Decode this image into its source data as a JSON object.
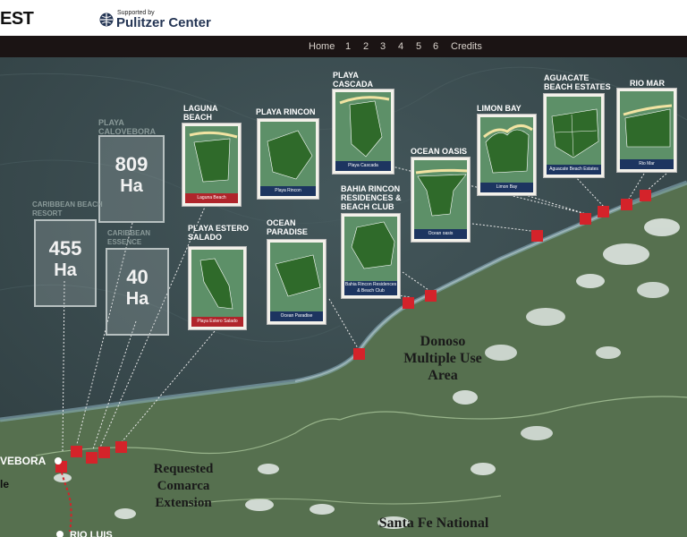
{
  "header": {
    "logo_text": "EST",
    "sponsor_small": "Supported by",
    "sponsor_name": "Pulitzer Center"
  },
  "nav": {
    "items": [
      "Home",
      "1",
      "2",
      "3",
      "4",
      "5",
      "6",
      "Credits"
    ]
  },
  "colors": {
    "sea": "#3a4b4e",
    "land": "#4f6a4c",
    "marker": "#d4232a",
    "card_bar": "#1d3560",
    "card_bar_red": "#b0252b"
  },
  "map": {
    "areas": [
      {
        "name": "Donoso Multiple Use Area",
        "lines": [
          "Donoso",
          "Multiple Use",
          "Area"
        ]
      },
      {
        "name": "Requested Comarca Extension",
        "lines": [
          "Requested",
          "Comarca",
          "Extension"
        ]
      },
      {
        "name": "Santa Fe National Park",
        "lines": [
          "Santa Fe National"
        ]
      }
    ],
    "towns": [
      "VEBORA",
      "RIO LUIS"
    ],
    "edge_text": "le",
    "area_stats": [
      {
        "label": "Playa Calovebora",
        "value": "809",
        "unit": "Ha"
      },
      {
        "label": "Caribbean Beach Resort",
        "value": "455",
        "unit": "Ha"
      },
      {
        "label": "Caribbean Essence",
        "value": "40",
        "unit": "Ha"
      }
    ],
    "projects": [
      {
        "label": "Laguna Beach",
        "card": "Laguna Beach"
      },
      {
        "label": "Playa Rincon",
        "card": "Playa Rincon"
      },
      {
        "label": "Playa Cascada",
        "card": "Playa Cascada"
      },
      {
        "label": "Limon Bay",
        "card": "Limon Bay"
      },
      {
        "label": "Aguacate Beach Estates",
        "card": "Aguacate Beach Estates"
      },
      {
        "label": "Rio Mar",
        "card": "Rio Mar"
      },
      {
        "label": "Ocean Oasis",
        "card": "Ocean oasis"
      },
      {
        "label": "Bahia Rincon Residences & Beach Club",
        "card": "Bahia Rincon Residences & Beach Club"
      },
      {
        "label": "Ocean Paradise",
        "card": "Ocean Paradise"
      },
      {
        "label": "Playa Estero Salado",
        "card": "Playa Estero Salado"
      }
    ]
  }
}
